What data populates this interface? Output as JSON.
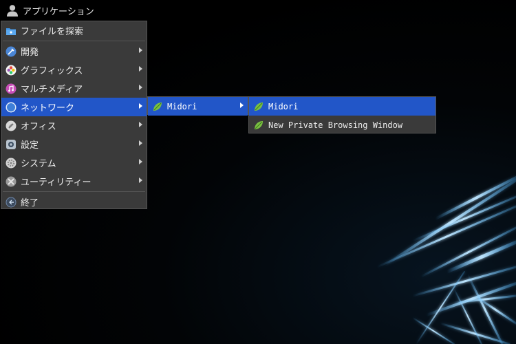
{
  "panel": {
    "app_menu_label": "アプリケーション"
  },
  "main_menu": {
    "search_label": "ファイルを探索",
    "items": [
      {
        "label": "開発",
        "icon": "development-icon"
      },
      {
        "label": "グラフィックス",
        "icon": "graphics-icon"
      },
      {
        "label": "マルチメディア",
        "icon": "multimedia-icon"
      },
      {
        "label": "ネットワーク",
        "icon": "network-icon"
      },
      {
        "label": "オフィス",
        "icon": "office-icon"
      },
      {
        "label": "設定",
        "icon": "settings-icon"
      },
      {
        "label": "システム",
        "icon": "system-icon"
      },
      {
        "label": "ユーティリティー",
        "icon": "utilities-icon"
      }
    ],
    "logout_label": "終了"
  },
  "network_menu": {
    "items": [
      {
        "label": "Midori",
        "icon": "midori-icon"
      }
    ]
  },
  "midori_menu": {
    "items": [
      {
        "label": "Midori",
        "icon": "midori-icon"
      },
      {
        "label": "New Private Browsing Window",
        "icon": "midori-icon"
      }
    ]
  },
  "colors": {
    "menu_bg": "#3a3a3a",
    "highlight": "#2256c8",
    "text": "#ececec"
  }
}
